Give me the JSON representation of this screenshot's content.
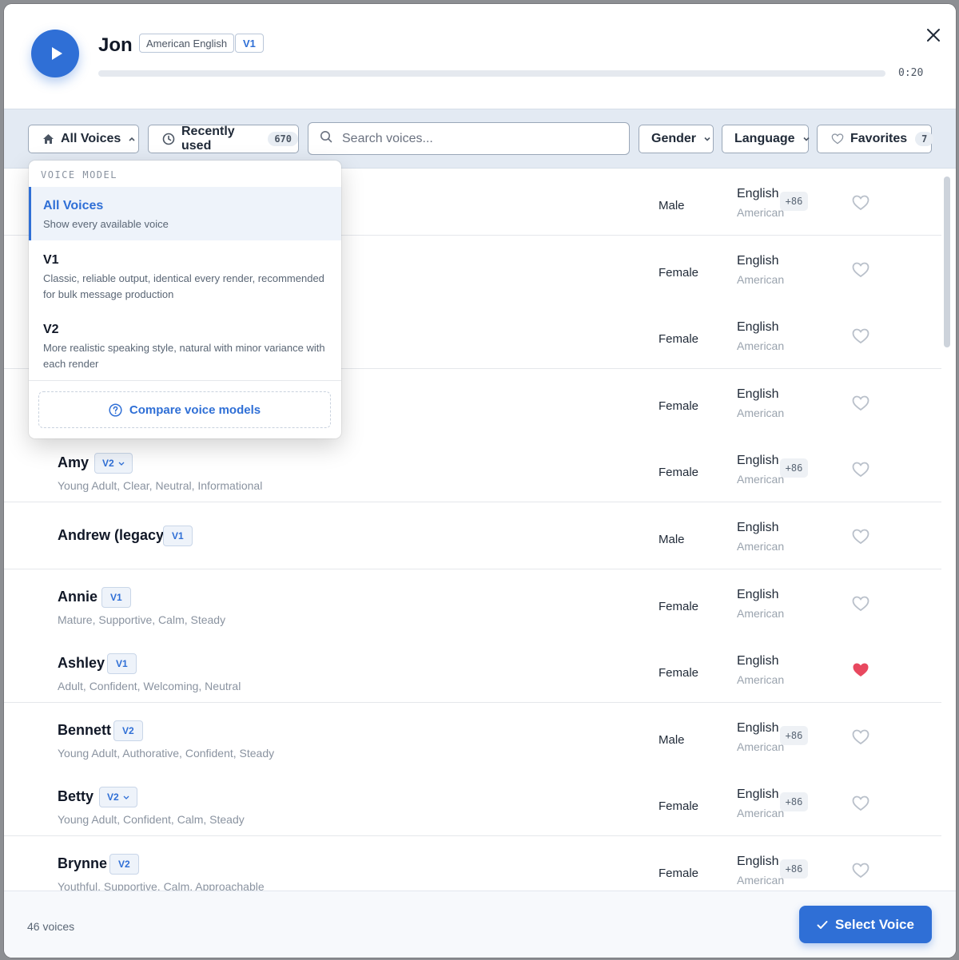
{
  "player": {
    "voice_name": "Jon",
    "language_tag": "American English",
    "version_tag": "V1",
    "progress": 0,
    "time": "0:20",
    "play_icon": "play-icon",
    "close_icon": "close-icon"
  },
  "filters": {
    "all_voices_label": "All Voices",
    "recently_used_label": "Recently used",
    "recently_used_count": "670",
    "search_placeholder": "Search voices...",
    "gender_label": "Gender",
    "language_label": "Language",
    "favorites_label": "Favorites",
    "favorites_count": "7"
  },
  "dropdown": {
    "heading": "VOICE MODEL",
    "items": [
      {
        "title": "All Voices",
        "sub": "Show every available voice",
        "active": true
      },
      {
        "title": "V1",
        "sub": "Classic, reliable output, identical every render, recommended for bulk message production",
        "active": false
      },
      {
        "title": "V2",
        "sub": "More realistic speaking style, natural with minor variance with each render",
        "active": false
      }
    ],
    "compare_label": "Compare voice models"
  },
  "voices": [
    {
      "name": "",
      "badge": "",
      "desc": "",
      "gender": "Male",
      "language": "English",
      "accent": "American",
      "extra": "+86",
      "favorite": false
    },
    {
      "name": "",
      "badge": "",
      "desc": "",
      "gender": "Female",
      "language": "English",
      "accent": "American",
      "extra": "",
      "favorite": false
    },
    {
      "name": "",
      "badge": "",
      "desc": "",
      "gender": "Female",
      "language": "English",
      "accent": "American",
      "extra": "",
      "favorite": false
    },
    {
      "name": "",
      "badge": "",
      "desc": "",
      "gender": "Female",
      "language": "English",
      "accent": "American",
      "extra": "",
      "favorite": false
    },
    {
      "name": "Amy",
      "badge": "V2",
      "badge_dropdown": true,
      "desc": "Young Adult, Clear, Neutral, Informational",
      "gender": "Female",
      "language": "English",
      "accent": "American",
      "extra": "+86",
      "favorite": false
    },
    {
      "name": "Andrew (legacy)",
      "badge": "V1",
      "desc": "",
      "gender": "Male",
      "language": "English",
      "accent": "American",
      "extra": "",
      "favorite": false
    },
    {
      "name": "Annie",
      "badge": "V1",
      "desc": "Mature, Supportive, Calm, Steady",
      "gender": "Female",
      "language": "English",
      "accent": "American",
      "extra": "",
      "favorite": false
    },
    {
      "name": "Ashley",
      "badge": "V1",
      "desc": "Adult, Confident, Welcoming, Neutral",
      "gender": "Female",
      "language": "English",
      "accent": "American",
      "extra": "",
      "favorite": true
    },
    {
      "name": "Bennett",
      "badge": "V2",
      "desc": "Young Adult, Authorative, Confident, Steady",
      "gender": "Male",
      "language": "English",
      "accent": "American",
      "extra": "+86",
      "favorite": false
    },
    {
      "name": "Betty",
      "badge": "V2",
      "badge_dropdown": true,
      "desc": "Young Adult, Confident, Calm, Steady",
      "gender": "Female",
      "language": "English",
      "accent": "American",
      "extra": "+86",
      "favorite": false
    },
    {
      "name": "Brynne",
      "badge": "V2",
      "desc": "Youthful, Supportive, Calm, Approachable",
      "gender": "Female",
      "language": "English",
      "accent": "American",
      "extra": "+86",
      "favorite": false
    }
  ],
  "footer": {
    "voice_count": "46 voices",
    "select_label": "Select Voice"
  },
  "colors": {
    "accent": "#2f6fd6",
    "heart_active": "#e8485f",
    "heart_inactive": "#b9c0ca"
  }
}
